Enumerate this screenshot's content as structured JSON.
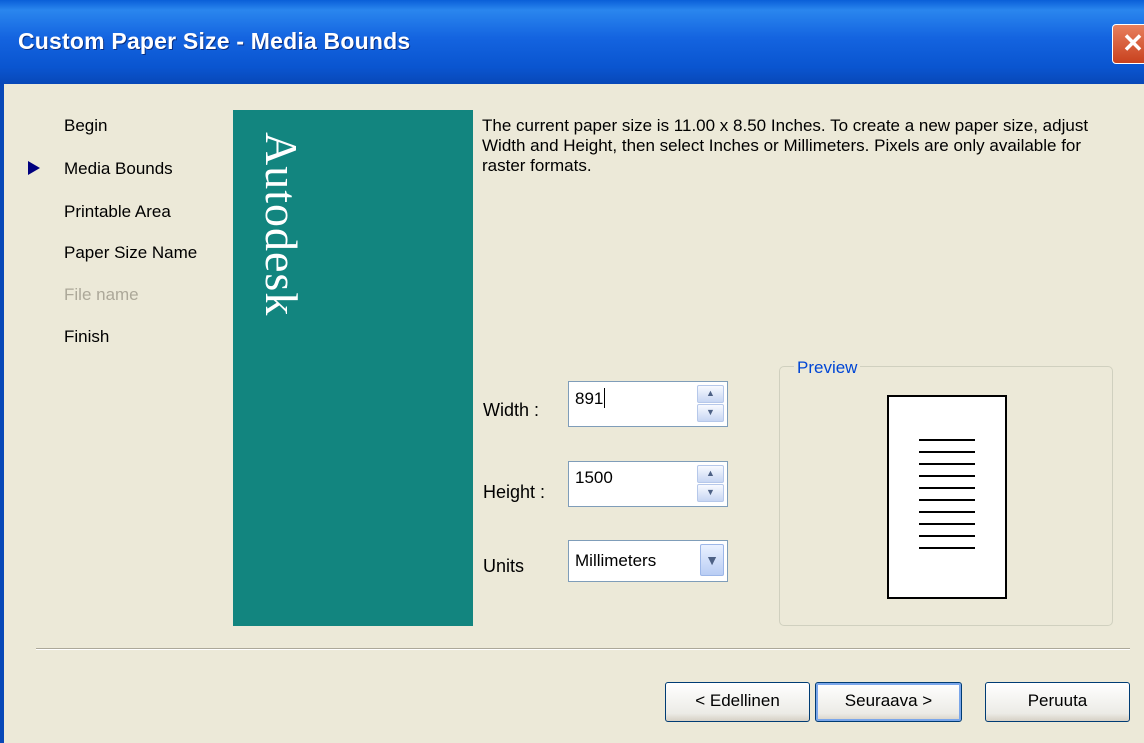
{
  "window": {
    "title": "Custom Paper Size - Media Bounds",
    "close_glyph": "✕"
  },
  "steps": [
    {
      "label": "Begin",
      "state": "normal"
    },
    {
      "label": "Media Bounds",
      "state": "current"
    },
    {
      "label": "Printable Area",
      "state": "normal"
    },
    {
      "label": "Paper Size Name",
      "state": "normal"
    },
    {
      "label": "File name",
      "state": "disabled"
    },
    {
      "label": "Finish",
      "state": "normal"
    }
  ],
  "banner": {
    "brand": "Autodesk",
    "color": "#12857f"
  },
  "description": "The current paper size is 11.00 x 8.50 Inches. To create a new paper size, adjust Width and Height, then select Inches or Millimeters. Pixels are only available for raster formats.",
  "form": {
    "width_label": "Width :",
    "width_value": "891",
    "height_label": "Height :",
    "height_value": "1500",
    "units_label": "Units",
    "units_value": "Millimeters"
  },
  "preview": {
    "title": "Preview"
  },
  "buttons": {
    "back": "< Edellinen",
    "next": "Seuraava >",
    "cancel": "Peruuta"
  },
  "icons": {
    "current_step": "arrow-right-icon",
    "spin_up": "spin-up-icon",
    "spin_down": "spin-down-icon",
    "dropdown": "chevron-down-icon"
  }
}
